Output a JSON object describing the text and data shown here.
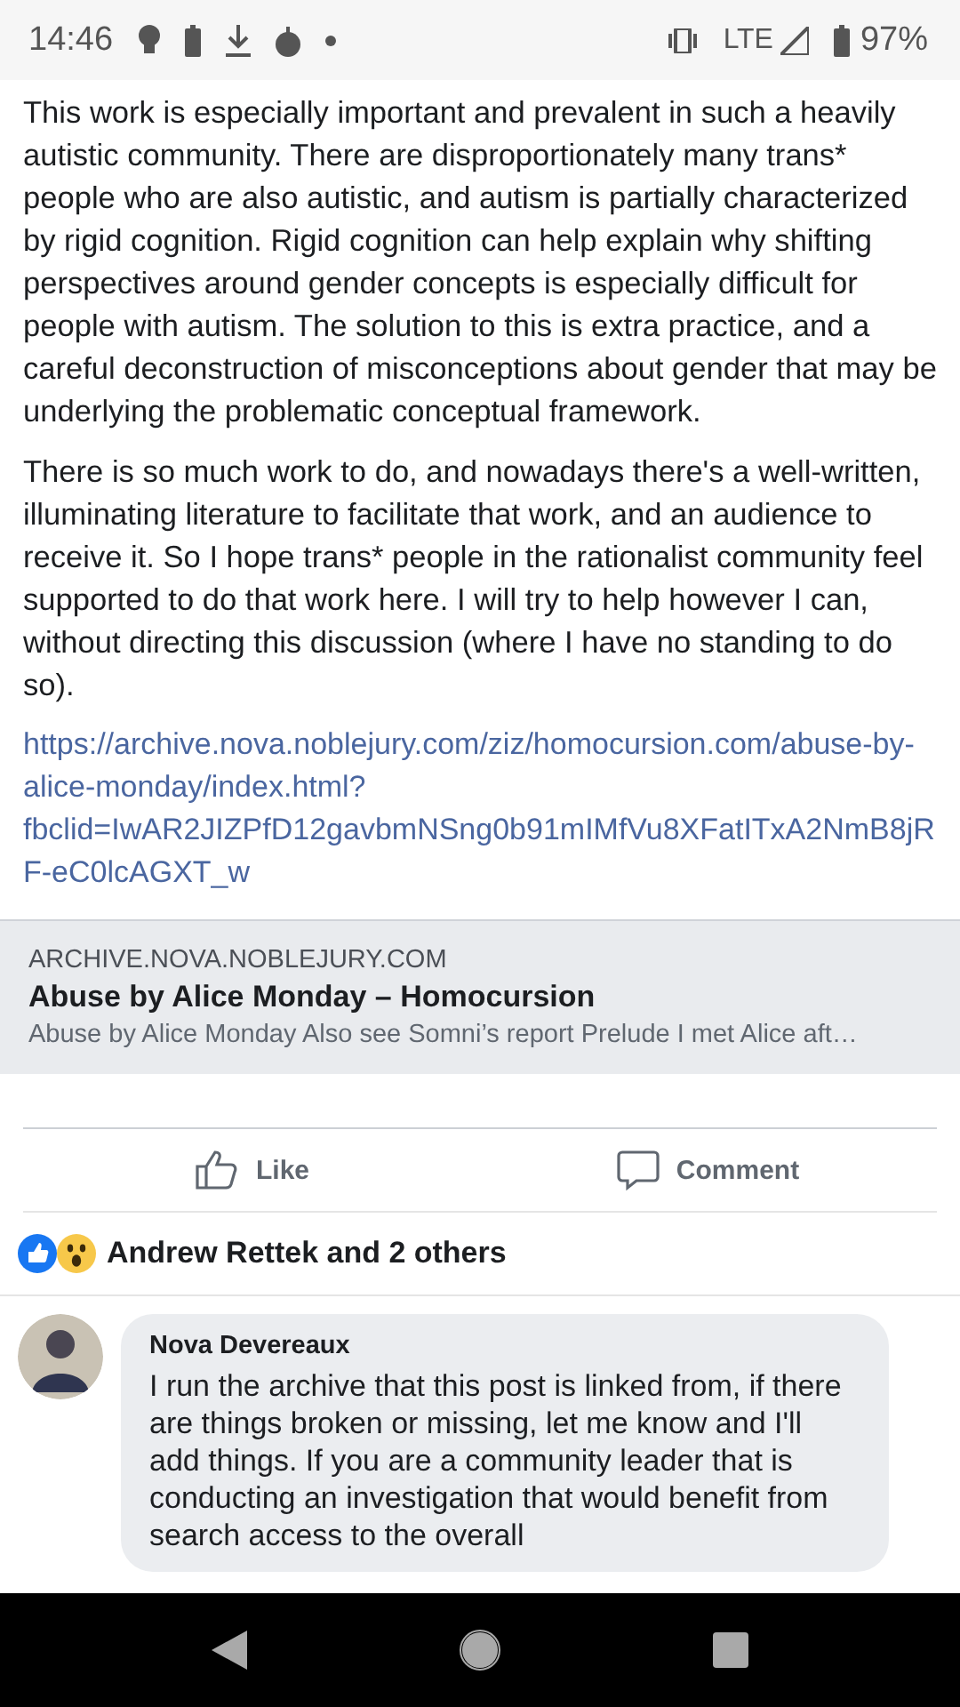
{
  "status_bar": {
    "time": "14:46",
    "battery": "97%",
    "network": "LTE"
  },
  "post": {
    "paragraphs": [
      "This work is especially important and prevalent in such a heavily autistic community. There are disproportionately many trans* people who are also autistic, and autism is partially characterized by rigid cognition. Rigid cognition can help explain why shifting perspectives around gender concepts is especially difficult for people with autism. The solution to this is extra practice, and a careful deconstruction of misconceptions about gender that may be underlying the problematic conceptual framework.",
      "There is so much work to do, and nowadays there's a well-written, illuminating literature to facilitate that work, and an audience to receive it. So I hope trans* people in the rationalist community feel supported to do that work here. I will try to help however I can, without directing this discussion (where I have no standing to do so)."
    ],
    "link": "https://archive.nova.noblejury.com/ziz/homocursion.com/abuse-by-alice-monday/index.html?fbclid=IwAR2JIZPfD12gavbmNSng0b91mIMfVu8XFatITxA2NmB8jRF-eC0lcAGXT_w",
    "link_preview": {
      "domain": "ARCHIVE.NOVA.NOBLEJURY.COM",
      "title": "Abuse by Alice Monday – Homocursion",
      "description": "Abuse by Alice Monday Also see Somni’s report Prelude I met Alice aft…"
    }
  },
  "actions": [
    {
      "kind": "like",
      "label": "Like"
    },
    {
      "kind": "comment",
      "label": "Comment"
    }
  ],
  "reactions": {
    "summary": "Andrew Rettek and 2 others"
  },
  "comments": [
    {
      "author": "Nova Devereaux",
      "text": "I run the archive that this post is linked from, if there are things broken or missing, let me know and I'll add things. If you are a community leader that is conducting an investigation that would benefit from search access to the overall"
    }
  ]
}
